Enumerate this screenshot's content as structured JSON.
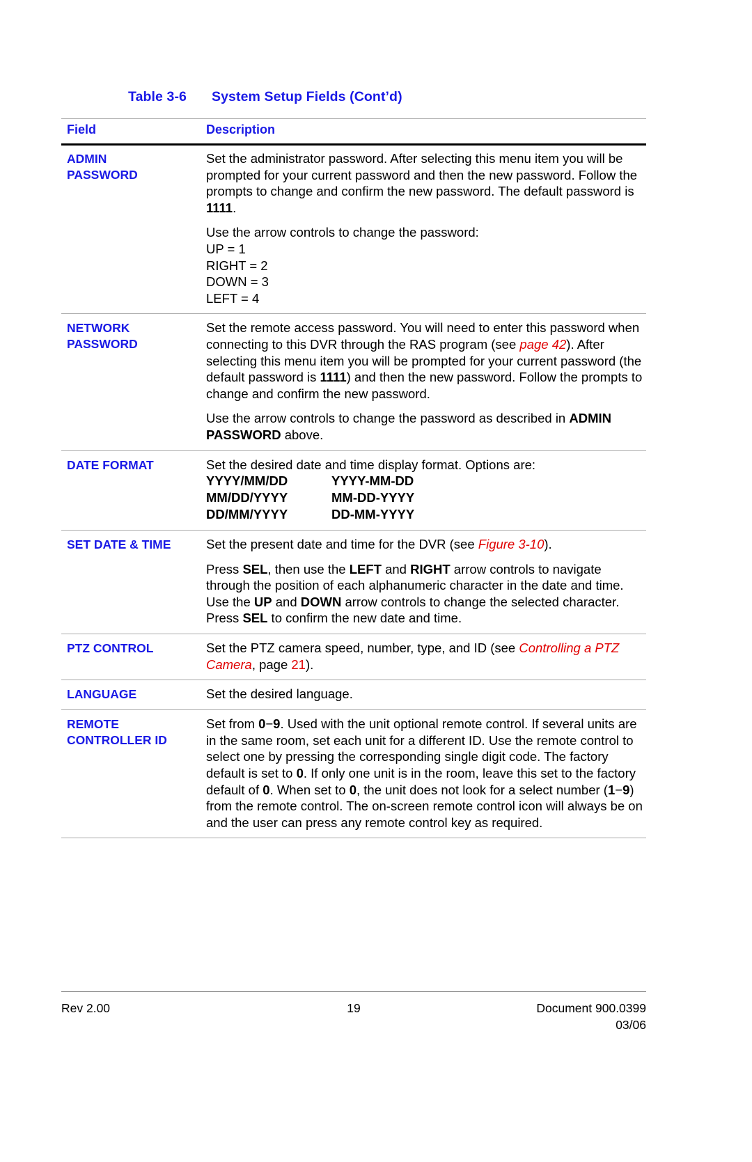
{
  "document": {
    "table_caption_number": "Table 3-6",
    "table_caption_title": "System Setup Fields  (Cont’d)",
    "heading_accent_color": "#1a1ae6",
    "xref_color": "#e00000"
  },
  "table": {
    "headers": {
      "field": "Field",
      "description": "Description"
    },
    "rows": [
      {
        "field_line1": "ADMIN",
        "field_line2": "PASSWORD",
        "para1_a": "Set the administrator password. After selecting this menu item you will be prompted for your current password and then the new password. Follow the prompts to change and confirm the new password. The default password is ",
        "para1_bold": "1111",
        "para1_b": ".",
        "para2": "Use the arrow controls to change the password:",
        "arrow_lines": [
          "UP = 1",
          "RIGHT = 2",
          "DOWN = 3",
          "LEFT = 4"
        ]
      },
      {
        "field_line1": "NETWORK",
        "field_line2": "PASSWORD",
        "para1_a": "Set the remote access password. You will need to enter this password when connecting to this DVR through the RAS program (see ",
        "para1_xref": "page 42",
        "para1_b": "). After selecting this menu item you will be prompted for your current password (the default password is ",
        "para1_bold": "1111",
        "para1_c": ") and then the new password. Follow the prompts to change and confirm the new password.",
        "para2_a": "Use the arrow controls to change the password as described in ",
        "para2_bold": "ADMIN PASSWORD",
        "para2_b": " above."
      },
      {
        "field_line1": "DATE FORMAT",
        "para1": "Set the desired date and time display format. Options are:",
        "options": [
          {
            "left": "YYYY/MM/DD",
            "right": "YYYY-MM-DD"
          },
          {
            "left": "MM/DD/YYYY",
            "right": "MM-DD-YYYY"
          },
          {
            "left": "DD/MM/YYYY",
            "right": "DD-MM-YYYY"
          }
        ]
      },
      {
        "field_line1": "SET DATE & TIME",
        "para1_a": "Set the present date and time for the DVR (see ",
        "para1_xref": "Figure 3-10",
        "para1_b": ").",
        "para2_a": "Press ",
        "para2_k1": "SEL",
        "para2_b": ", then use the ",
        "para2_k2": "LEFT",
        "para2_c": " and ",
        "para2_k3": "RIGHT",
        "para2_d": " arrow controls to navigate through the position of each alphanumeric character in the date and time. Use the ",
        "para2_k4": "UP",
        "para2_e": " and ",
        "para2_k5": "DOWN",
        "para2_f": " arrow controls to change the selected character. Press ",
        "para2_k6": "SEL",
        "para2_g": " to confirm the new date and time."
      },
      {
        "field_line1": "PTZ CONTROL",
        "para1_a": "Set the PTZ camera speed, number, type, and ID (see ",
        "para1_xref1": "Controlling a PTZ Camera",
        "para1_b": ", page ",
        "para1_xref2": "21",
        "para1_c": ")."
      },
      {
        "field_line1": "LANGUAGE",
        "para1": "Set the desired language."
      },
      {
        "field_line1": "REMOTE",
        "field_line2": "CONTROLLER ID",
        "para1_a": "Set from ",
        "para1_b1": "0",
        "para1_dash1": "−",
        "para1_b2": "9",
        "para1_b": ". Used with the unit optional remote control. If several units are in the same room, set each unit for a different ID. Use the remote control to select one by pressing the corresponding single digit code. The factory default is set to ",
        "para1_b3": "0",
        "para1_c": ". If only one unit is in the room, leave this set to the factory default of ",
        "para1_b4": "0",
        "para1_d": ". When set to ",
        "para1_b5": "0",
        "para1_e": ", the unit does not look for a select number (",
        "para1_b6": "1",
        "para1_dash2": "−",
        "para1_b7": "9",
        "para1_f": ") from the remote control. The on-screen remote control icon will always be on and the user can press any remote control key as required."
      }
    ]
  },
  "footer": {
    "revision": "Rev 2.00",
    "page_number": "19",
    "document_number": "Document 900.0399",
    "date": "03/06"
  }
}
